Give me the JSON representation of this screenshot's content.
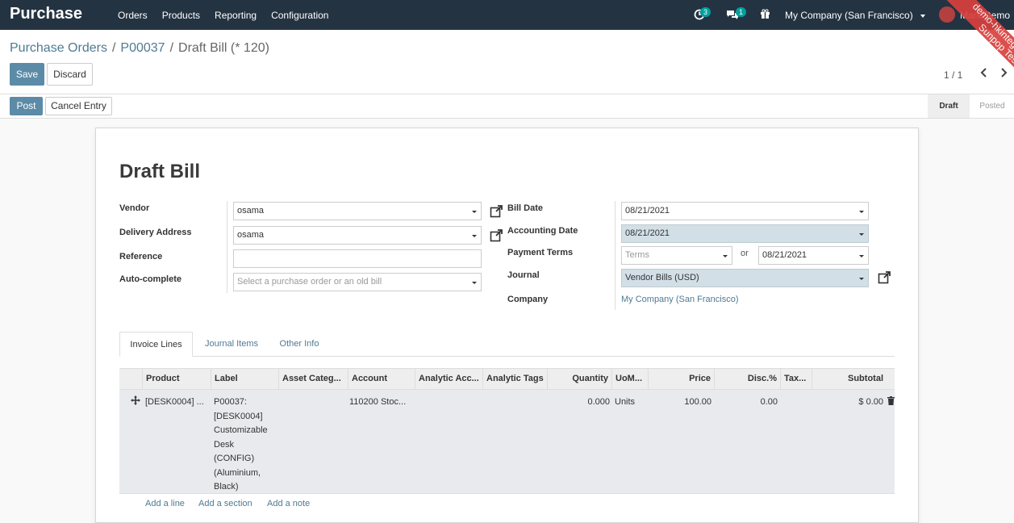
{
  "app": {
    "name": "Purchase"
  },
  "nav": {
    "orders": "Orders",
    "products": "Products",
    "reporting": "Reporting",
    "configuration": "Configuration"
  },
  "systray": {
    "activity_count": "3",
    "messages_count": "1",
    "company": "My Company (San Francisco)",
    "user": "Mark Demo"
  },
  "ribbon": {
    "line1": "demo-hkintegration-o",
    "line2": "Sunpop Test"
  },
  "breadcrumb": {
    "root": "Purchase Orders",
    "order": "P00037",
    "current": "Draft Bill (* 120)"
  },
  "buttons": {
    "save": "Save",
    "discard": "Discard",
    "post": "Post",
    "cancel_entry": "Cancel Entry"
  },
  "pager": {
    "value": "1 / 1"
  },
  "status": {
    "draft": "Draft",
    "posted": "Posted"
  },
  "form": {
    "title": "Draft Bill",
    "vendor": {
      "label": "Vendor",
      "value": "osama"
    },
    "delivery": {
      "label": "Delivery Address",
      "value": "osama"
    },
    "reference": {
      "label": "Reference",
      "value": ""
    },
    "autocomplete": {
      "label": "Auto-complete",
      "placeholder": "Select a purchase order or an old bill"
    },
    "bill_date": {
      "label": "Bill Date",
      "value": "08/21/2021"
    },
    "accounting_date": {
      "label": "Accounting Date",
      "value": "08/21/2021"
    },
    "payment_terms": {
      "label": "Payment Terms",
      "placeholder": "Terms",
      "or": "or",
      "due_date": "08/21/2021"
    },
    "journal": {
      "label": "Journal",
      "value": "Vendor Bills (USD)"
    },
    "company": {
      "label": "Company",
      "value": "My Company (San Francisco)"
    }
  },
  "tabs": {
    "invoice_lines": "Invoice Lines",
    "journal_items": "Journal Items",
    "other_info": "Other Info"
  },
  "table": {
    "headers": {
      "product": "Product",
      "label": "Label",
      "asset": "Asset Categ...",
      "account": "Account",
      "analytic_account": "Analytic Acc...",
      "analytic_tags": "Analytic Tags",
      "quantity": "Quantity",
      "uom": "UoM...",
      "price": "Price",
      "disc": "Disc.%",
      "tax": "Tax...",
      "subtotal": "Subtotal"
    },
    "row": {
      "product": "[DESK0004] ...",
      "label_lines": [
        "P00037:",
        "[DESK0004]",
        "Customizable",
        "Desk",
        "(CONFIG)",
        "(Aluminium,",
        "Black)"
      ],
      "account": "110200 Stoc...",
      "quantity": "0.000",
      "uom": "Units",
      "price": "100.00",
      "disc": "0.00",
      "subtotal": "$ 0.00"
    },
    "add_line": "Add a line",
    "add_section": "Add a section",
    "add_note": "Add a note"
  }
}
